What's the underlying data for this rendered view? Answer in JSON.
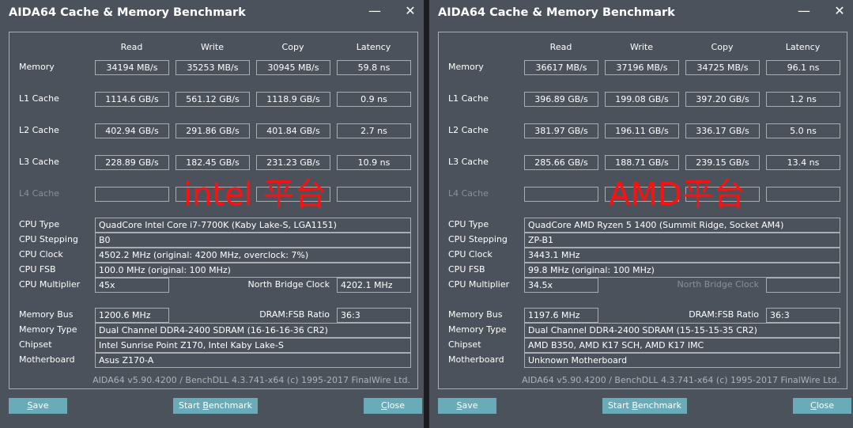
{
  "columns": [
    "Read",
    "Write",
    "Copy",
    "Latency"
  ],
  "row_labels": [
    "Memory",
    "L1 Cache",
    "L2 Cache",
    "L3 Cache",
    "L4 Cache"
  ],
  "info_labels": {
    "cpu_type": "CPU Type",
    "cpu_stepping": "CPU Stepping",
    "cpu_clock": "CPU Clock",
    "cpu_fsb": "CPU FSB",
    "cpu_multiplier": "CPU Multiplier",
    "nb_clock": "North Bridge Clock",
    "memory_bus": "Memory Bus",
    "dram_fsb": "DRAM:FSB Ratio",
    "memory_type": "Memory Type",
    "chipset": "Chipset",
    "motherboard": "Motherboard"
  },
  "buttons": {
    "save_pre": "",
    "save_u": "S",
    "save_post": "ave",
    "start_pre": "Start ",
    "start_u": "B",
    "start_post": "enchmark",
    "close_pre": "",
    "close_u": "C",
    "close_post": "lose"
  },
  "window_controls": {
    "minimize": "—",
    "close": "✕"
  },
  "panels": [
    {
      "title": "AIDA64 Cache & Memory Benchmark",
      "overlay": "intel 平台",
      "results": [
        [
          "34194 MB/s",
          "35253 MB/s",
          "30945 MB/s",
          "59.8 ns"
        ],
        [
          "1114.6 GB/s",
          "561.12 GB/s",
          "1118.9 GB/s",
          "0.9 ns"
        ],
        [
          "402.94 GB/s",
          "291.86 GB/s",
          "401.84 GB/s",
          "2.7 ns"
        ],
        [
          "228.89 GB/s",
          "182.45 GB/s",
          "231.23 GB/s",
          "10.9 ns"
        ],
        [
          "",
          "",
          "",
          ""
        ]
      ],
      "info": {
        "cpu_type": "QuadCore Intel Core i7-7700K  (Kaby Lake-S, LGA1151)",
        "cpu_stepping": "B0",
        "cpu_clock": "4502.2 MHz  (original: 4200 MHz, overclock: 7%)",
        "cpu_fsb": "100.0 MHz  (original: 100 MHz)",
        "cpu_multiplier": "45x",
        "nb_clock": "4202.1 MHz",
        "memory_bus": "1200.6 MHz",
        "dram_fsb": "36:3",
        "memory_type": "Dual Channel DDR4-2400 SDRAM  (16-16-16-36 CR2)",
        "chipset": "Intel Sunrise Point Z170, Intel Kaby Lake-S",
        "motherboard": "Asus Z170-A"
      },
      "footer": "AIDA64 v5.90.4200 / BenchDLL 4.3.741-x64  (c) 1995-2017 FinalWire Ltd."
    },
    {
      "title": "AIDA64 Cache & Memory Benchmark",
      "overlay": "AMD平台",
      "results": [
        [
          "36617 MB/s",
          "37196 MB/s",
          "34725 MB/s",
          "96.1 ns"
        ],
        [
          "396.89 GB/s",
          "199.08 GB/s",
          "397.20 GB/s",
          "1.2 ns"
        ],
        [
          "381.97 GB/s",
          "196.11 GB/s",
          "336.17 GB/s",
          "5.0 ns"
        ],
        [
          "285.66 GB/s",
          "188.71 GB/s",
          "239.15 GB/s",
          "13.4 ns"
        ],
        [
          "",
          "",
          "",
          ""
        ]
      ],
      "info": {
        "cpu_type": "QuadCore AMD Ryzen 5 1400  (Summit Ridge, Socket AM4)",
        "cpu_stepping": "ZP-B1",
        "cpu_clock": "3443.1 MHz",
        "cpu_fsb": "99.8 MHz  (original: 100 MHz)",
        "cpu_multiplier": "34.5x",
        "nb_clock": "",
        "memory_bus": "1197.6 MHz",
        "dram_fsb": "36:3",
        "memory_type": "Dual Channel DDR4-2400 SDRAM  (15-15-15-35 CR2)",
        "chipset": "AMD B350, AMD K17 SCH, AMD K17 IMC",
        "motherboard": "Unknown Motherboard"
      },
      "footer": "AIDA64 v5.90.4200 / BenchDLL 4.3.741-x64  (c) 1995-2017 FinalWire Ltd."
    }
  ]
}
